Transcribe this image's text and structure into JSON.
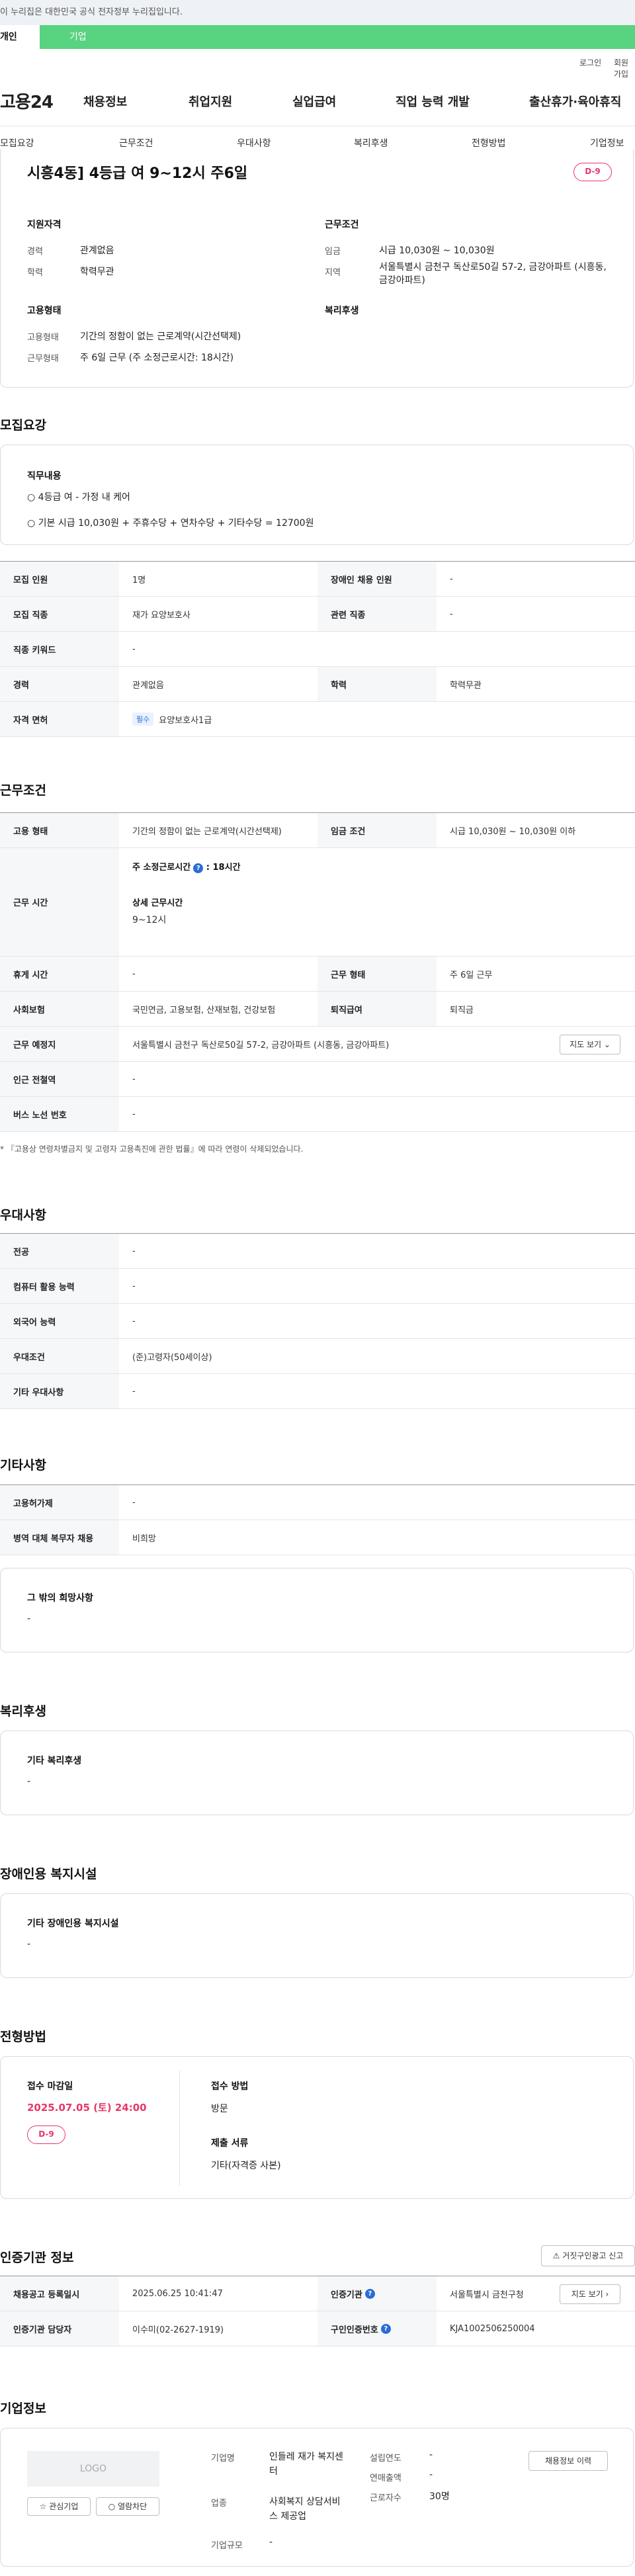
{
  "top_notice": "이 누리집은 대한민국 공식 전자정부 누리집입니다.",
  "user_tabs": [
    "개인",
    "기업"
  ],
  "util_links": [
    "로그인",
    "회원가입"
  ],
  "logo": "고용24",
  "gnb": [
    "채용정보",
    "취업지원",
    "실업급여",
    "직업 능력 개발",
    "출산휴가·육아휴직"
  ],
  "anchors": [
    "모집요강",
    "근무조건",
    "우대사항",
    "복리후생",
    "전형방법",
    "기업정보"
  ],
  "summary": {
    "title": "시흥4동] 4등급 여 9~12시 주6일",
    "dday": "D-9",
    "qual_title": "지원자격",
    "cond_title": "근무조건",
    "career_label": "경력",
    "career": "관계없음",
    "edu_label": "학력",
    "edu": "학력무관",
    "wage_label": "임금",
    "wage": "시급 10,030원 ~ 10,030원",
    "region_label": "지역",
    "region": "서울특별시 금천구 독산로50길 57-2, 금강아파트 (시흥동, 금강아파트)",
    "emp_title": "고용형태",
    "welfare_title": "복리후생",
    "emp_type_label": "고용형태",
    "emp_type": "기간의 정함이 없는 근로계약(시간선택제)",
    "work_type_label": "근무형태",
    "work_type": "주 6일 근무 (주 소정근로시간: 18시간)"
  },
  "recruit": {
    "heading": "모집요강",
    "duty_title": "직무내용",
    "duty_lines": [
      "○ 4등급 여 - 가정 내 케어",
      "○ 기본 시급 10,030원 + 주휴수당 + 연차수당 + 기타수당 = 12700원"
    ],
    "rows": [
      [
        "모집 인원",
        "1명",
        "장애인 채용 인원",
        "-"
      ],
      [
        "모집 직종",
        "재가 요양보호사",
        "관련 직종",
        "-"
      ],
      [
        "직종 키워드",
        "-"
      ],
      [
        "경력",
        "관계없음",
        "학력",
        "학력무관"
      ],
      [
        "자격 면허",
        "요양보호사1급"
      ]
    ],
    "license_tag": "필수"
  },
  "work": {
    "heading": "근무조건",
    "emp_label": "고용 형태",
    "emp": "기간의 정함이 없는 근로계약(시간선택제)",
    "wage_label": "임금 조건",
    "wage": "시급 10,030원 ~ 10,030원 이하",
    "time_label": "근무 시간",
    "week_hours_label": "주 소정근로시간",
    "week_hours": ": 18시간",
    "detail_label": "상세 근무시간",
    "detail": "9~12시",
    "rows": [
      [
        "휴게 시간",
        "-",
        "근무 형태",
        "주 6일 근무"
      ],
      [
        "사회보험",
        "국민연금, 고용보험, 산재보험, 건강보험",
        "퇴직급여",
        "퇴직금"
      ],
      [
        "근무 예정지",
        "서울특별시 금천구 독산로50길 57-2, 금강아파트 (시흥동, 금강아파트)"
      ],
      [
        "인근 전철역",
        "-"
      ],
      [
        "버스 노선 번호",
        "-"
      ]
    ],
    "map_btn": "지도 보기",
    "footnote": "* 『고용상 연령차별금지 및 고령자 고용촉진에 관한 법률』에 따라 연령이 삭제되었습니다."
  },
  "prefer": {
    "heading": "우대사항",
    "rows": [
      [
        "전공",
        "-"
      ],
      [
        "컴퓨터 활용 능력",
        "-"
      ],
      [
        "외국어 능력",
        "-"
      ],
      [
        "우대조건",
        "(준)고령자(50세이상)"
      ],
      [
        "기타 우대사항",
        "-"
      ]
    ]
  },
  "etc": {
    "heading": "기타사항",
    "rows": [
      [
        "고용허가제",
        "-"
      ],
      [
        "병역 대체 복무자 채용",
        "비희망"
      ]
    ],
    "box_title": "그 밖의 희망사항",
    "box_val": "-"
  },
  "benefit": {
    "heading": "복리후생",
    "box_title": "기타 복리후생",
    "box_val": "-"
  },
  "disabled": {
    "heading": "장애인용 복지시설",
    "box_title": "기타 장애인용 복지시설",
    "box_val": "-"
  },
  "process": {
    "heading": "전형방법",
    "deadline_label": "접수 마감일",
    "deadline": "2025.07.05 (토) 24:00",
    "dday": "D-9",
    "method_label": "접수 방법",
    "method": "방문",
    "docs_label": "제출 서류",
    "docs": "기타(자격증 사본)"
  },
  "agency": {
    "heading": "인증기관 정보",
    "report_btn": "거짓구인광고 신고",
    "rows": [
      [
        "채용공고 등록일시",
        "2025.06.25 10:41:47",
        "인증기관",
        "서울특별시 금천구청"
      ],
      [
        "인증기관 담당자",
        "이수미(02-2627-1919)",
        "구인인증번호",
        "KJA1002506250004"
      ]
    ],
    "map_btn": "지도 보기"
  },
  "company": {
    "heading": "기업정보",
    "logo": "LOGO",
    "fav_btn": "관심기업",
    "block_btn": "열람차단",
    "name_label": "기업명",
    "name": "인들레 재가 복지센터",
    "biz_label": "업종",
    "biz": "사회복지 상담서비스 제공업",
    "size_label": "기업규모",
    "size": "-",
    "year_label": "설립연도",
    "year": "-",
    "sales_label": "연매출액",
    "sales": "-",
    "staff_label": "근로자수",
    "staff": "30명",
    "history_btn": "채용정보 이력"
  },
  "colors": {
    "accent_green": "#58d37f",
    "dday_pink": "#e8366a",
    "link_blue": "#2b6cd8"
  }
}
